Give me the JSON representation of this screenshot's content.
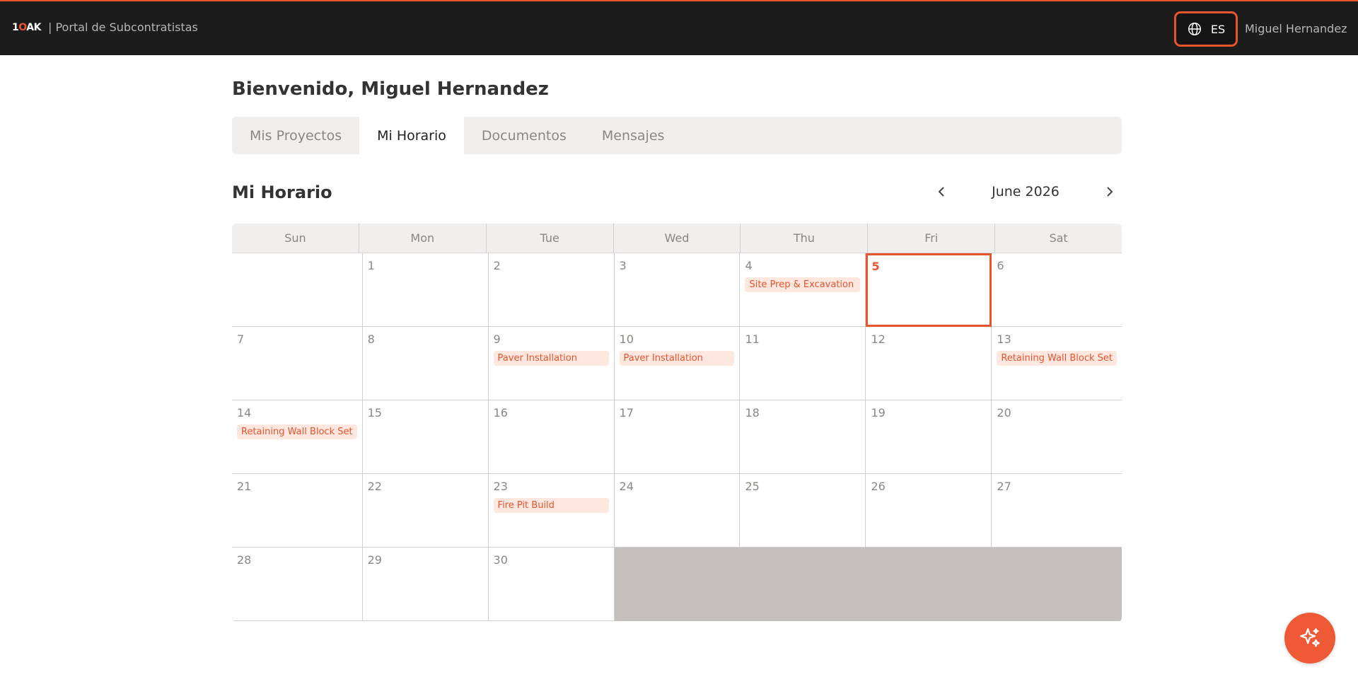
{
  "header": {
    "logo_text_1": "1",
    "logo_text_o": "O",
    "logo_text_ak": "AK",
    "portal_title": "| Portal de Subcontratistas",
    "language": "ES",
    "user_name": "Miguel Hernandez"
  },
  "welcome": "Bienvenido, Miguel Hernandez",
  "tabs": [
    {
      "label": "Mis Proyectos"
    },
    {
      "label": "Mi Horario"
    },
    {
      "label": "Documentos"
    },
    {
      "label": "Mensajes"
    }
  ],
  "schedule": {
    "title": "Mi Horario",
    "month_label": "June 2026",
    "prev_arrow": "‹",
    "next_arrow": "›",
    "weekdays": [
      "Sun",
      "Mon",
      "Tue",
      "Wed",
      "Thu",
      "Fri",
      "Sat"
    ],
    "today": 5,
    "days": [
      {
        "num": ""
      },
      {
        "num": "1"
      },
      {
        "num": "2"
      },
      {
        "num": "3"
      },
      {
        "num": "4",
        "event": "Site Prep & Excavation"
      },
      {
        "num": "5"
      },
      {
        "num": "6"
      },
      {
        "num": "7"
      },
      {
        "num": "8"
      },
      {
        "num": "9",
        "event": "Paver Installation"
      },
      {
        "num": "10",
        "event": "Paver Installation"
      },
      {
        "num": "11"
      },
      {
        "num": "12"
      },
      {
        "num": "13",
        "event": "Retaining Wall Block Set"
      },
      {
        "num": "14",
        "event": "Retaining Wall Block Set"
      },
      {
        "num": "15"
      },
      {
        "num": "16"
      },
      {
        "num": "17"
      },
      {
        "num": "18"
      },
      {
        "num": "19"
      },
      {
        "num": "20"
      },
      {
        "num": "21"
      },
      {
        "num": "22"
      },
      {
        "num": "23",
        "event": "Fire Pit Build"
      },
      {
        "num": "24"
      },
      {
        "num": "25"
      },
      {
        "num": "26"
      },
      {
        "num": "27"
      },
      {
        "num": "28"
      },
      {
        "num": "29"
      },
      {
        "num": "30"
      }
    ]
  },
  "colors": {
    "accent": "#e8542e",
    "topbar": "#1c1c1c",
    "event_bg": "#fde7df",
    "blank_cells": "#c5c0bd"
  },
  "icons": {
    "language": "globe-icon",
    "assistant": "sparkle-icon"
  }
}
